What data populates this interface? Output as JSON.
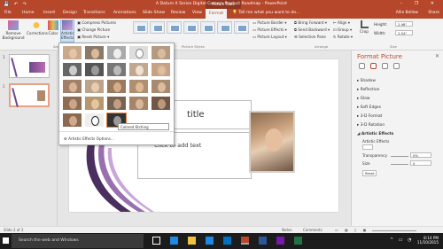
{
  "window": {
    "title": "A Datum X Series Digital Camera Product Roadmap - PowerPoint",
    "context_tab": "Picture Tools",
    "user": "Allie Bellew",
    "share": "Share"
  },
  "tabs": [
    "File",
    "Home",
    "Insert",
    "Design",
    "Transitions",
    "Animations",
    "Slide Show",
    "Review",
    "View",
    "Format"
  ],
  "tell_me": "Tell me what you want to do...",
  "ribbon": {
    "remove_background": "Remove Background",
    "corrections": "Corrections",
    "color": "Color",
    "artistic_effects": "Artistic Effects",
    "compress_pictures": "Compress Pictures",
    "change_picture": "Change Picture",
    "reset_picture": "Reset Picture",
    "picture_styles_label": "Picture Styles",
    "picture_border": "Picture Border",
    "picture_effects": "Picture Effects",
    "picture_layout": "Picture Layout",
    "bring_forward": "Bring Forward",
    "send_backward": "Send Backward",
    "selection_pane": "Selection Pane",
    "align": "Align",
    "group": "Group",
    "rotate": "Rotate",
    "arrange_label": "Arrange",
    "crop": "Crop",
    "height_label": "Height:",
    "height_value": "2.98\"",
    "width_label": "Width:",
    "width_value": "2.54\"",
    "size_label": "Size",
    "adjust_label": "Adju"
  },
  "gallery": {
    "tooltip": "Colored Etching",
    "options": "Artistic Effects Options..."
  },
  "slides": [
    {
      "num": "1"
    },
    {
      "num": "2"
    }
  ],
  "slide": {
    "title_placeholder": "title",
    "text_placeholder": "Click to add text"
  },
  "format_pane": {
    "title": "Format Picture",
    "sections": [
      "Shadow",
      "Reflection",
      "Glow",
      "Soft Edges",
      "3-D Format",
      "3-D Rotation"
    ],
    "open_section": "Artistic Effects",
    "artistic_effects_label": "Artistic Effects",
    "transparency_label": "Transparency",
    "transparency_value": "0%",
    "size_label": "Size",
    "size_value": "0",
    "reset": "Reset"
  },
  "status": {
    "slide": "Slide 2 of 2",
    "notes": "Notes",
    "comments": "Comments"
  },
  "taskbar": {
    "search": "Search the web and Windows",
    "time": "8:14 PM",
    "date": "11/10/2015"
  },
  "colors": {
    "accent": "#b7472a",
    "taskbar": "#1c1c1c"
  }
}
